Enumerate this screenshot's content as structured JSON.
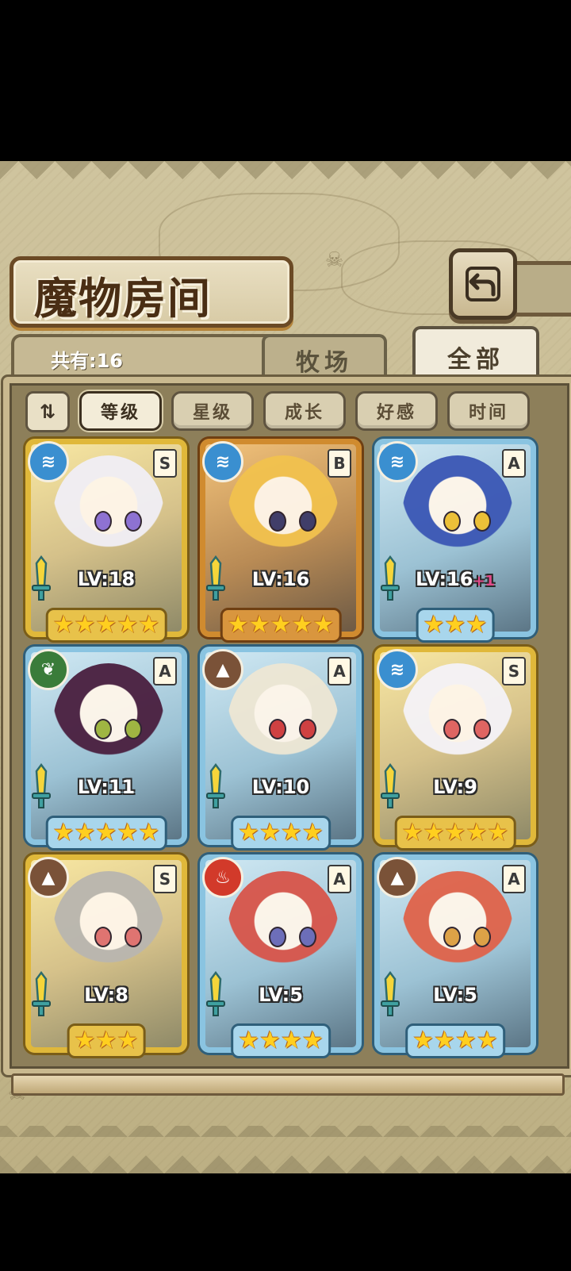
{
  "header": {
    "title": "魔物房间",
    "back_icon": "return-icon"
  },
  "summary": {
    "count_label": "共有:16"
  },
  "tabs": [
    {
      "label": "牧场",
      "selected": false
    },
    {
      "label": "全部",
      "selected": true
    }
  ],
  "sort": {
    "toggle_icon": "sort-order-icon",
    "options": [
      {
        "label": "等级",
        "selected": true
      },
      {
        "label": "星级",
        "selected": false
      },
      {
        "label": "成长",
        "selected": false
      },
      {
        "label": "好感",
        "selected": false
      },
      {
        "label": "时间",
        "selected": false
      }
    ]
  },
  "cards": [
    {
      "element": "water",
      "rank": "S",
      "frame": "gold",
      "level": "LV:18",
      "bonus": "",
      "stars": 5,
      "hair": "#f1eff6",
      "eye": "#8a6ed6"
    },
    {
      "element": "water",
      "rank": "B",
      "frame": "bronze",
      "level": "LV:16",
      "bonus": "",
      "stars": 5,
      "hair": "#f2c24e",
      "eye": "#3a3a6a"
    },
    {
      "element": "water",
      "rank": "A",
      "frame": "blue",
      "level": "LV:16",
      "bonus": "+1",
      "stars": 3,
      "hair": "#3b57b5",
      "eye": "#f0c030"
    },
    {
      "element": "wood",
      "rank": "A",
      "frame": "blue",
      "level": "LV:11",
      "bonus": "",
      "stars": 5,
      "hair": "#4a1f3f",
      "eye": "#9fb53a"
    },
    {
      "element": "earth",
      "rank": "A",
      "frame": "blue",
      "level": "LV:10",
      "bonus": "",
      "stars": 4,
      "hair": "#eee7d4",
      "eye": "#d23a3a"
    },
    {
      "element": "water",
      "rank": "S",
      "frame": "gold",
      "level": "LV:9",
      "bonus": "",
      "stars": 5,
      "hair": "#f5f3f8",
      "eye": "#e06060"
    },
    {
      "element": "earth",
      "rank": "S",
      "frame": "gold",
      "level": "LV:8",
      "bonus": "",
      "stars": 3,
      "hair": "#b9b6b0",
      "eye": "#e07070"
    },
    {
      "element": "fire",
      "rank": "A",
      "frame": "blue",
      "level": "LV:5",
      "bonus": "",
      "stars": 4,
      "hair": "#d8554a",
      "eye": "#6a6ab8"
    },
    {
      "element": "earth",
      "rank": "A",
      "frame": "blue",
      "level": "LV:5",
      "bonus": "",
      "stars": 4,
      "hair": "#e0634a",
      "eye": "#e0a040"
    }
  ]
}
